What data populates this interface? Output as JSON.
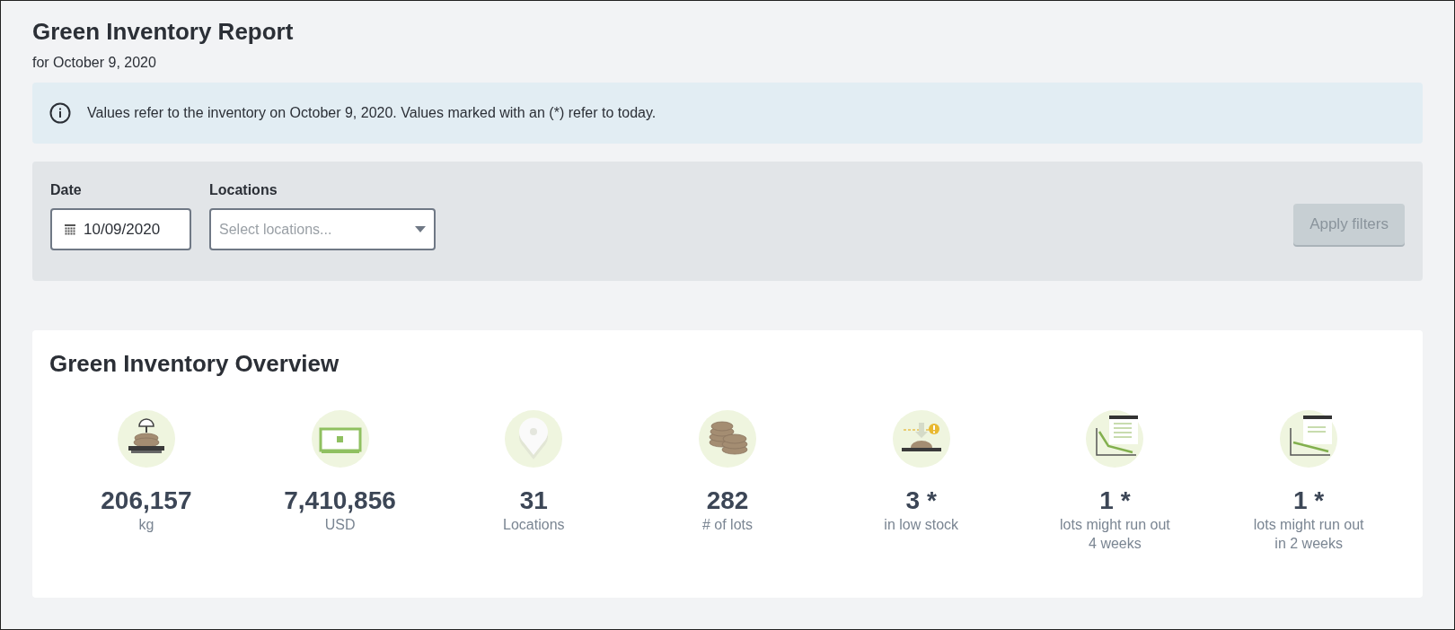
{
  "header": {
    "title": "Green Inventory Report",
    "subtitle": "for October 9, 2020"
  },
  "info_banner": {
    "text": "Values refer to the inventory on October 9, 2020. Values marked with an (*) refer to today."
  },
  "filters": {
    "date": {
      "label": "Date",
      "value": "10/09/2020"
    },
    "locations": {
      "label": "Locations",
      "placeholder": "Select locations..."
    },
    "apply_button": {
      "label": "Apply filters",
      "disabled": true
    }
  },
  "overview": {
    "title": "Green Inventory Overview",
    "stats": [
      {
        "kind": "scale",
        "value": "206,157",
        "label": "kg"
      },
      {
        "kind": "money",
        "value": "7,410,856",
        "label": "USD"
      },
      {
        "kind": "pin",
        "value": "31",
        "label": "Locations"
      },
      {
        "kind": "bags",
        "value": "282",
        "label": "# of lots"
      },
      {
        "kind": "low-stock",
        "value": "3 *",
        "label": "in low stock"
      },
      {
        "kind": "chart-steep",
        "value": "1 *",
        "label": "lots might run out\n4 weeks"
      },
      {
        "kind": "chart-flat",
        "value": "1 *",
        "label": "lots might run out\nin 2 weeks"
      }
    ]
  }
}
